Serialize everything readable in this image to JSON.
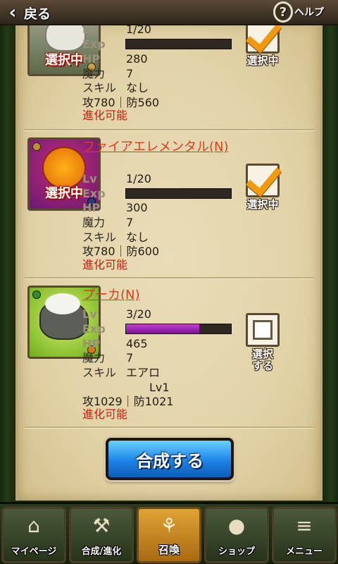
{
  "topbar": {
    "back_label": "戻る",
    "help_label": "ヘルプ"
  },
  "labels": {
    "lv": "Lv",
    "exp": "Exp",
    "hp": "HP",
    "magic": "魔力",
    "skill": "スキル",
    "selected_thumb": "選択中",
    "selected_btn": "選択中",
    "select_btn": "選択する"
  },
  "cards": [
    {
      "name": "",
      "lv": "1/20",
      "exp_fraction": 0.0,
      "hp": "280",
      "magic": "7",
      "skill": "なし",
      "atk_def": "攻780｜防560",
      "evolve": "進化可能",
      "selected": true
    },
    {
      "name": "ファイアエレメンタル(N)",
      "lv": "1/20",
      "exp_fraction": 0.0,
      "hp": "300",
      "magic": "7",
      "skill": "なし",
      "atk_def": "攻780｜防600",
      "evolve": "進化可能",
      "selected": true
    },
    {
      "name": "プーカ(N)",
      "lv": "3/20",
      "exp_fraction": 0.7,
      "hp": "465",
      "magic": "7",
      "skill": "エアロ",
      "skill_level": "Lv1",
      "atk_def": "攻1029｜防1021",
      "evolve": "進化可能",
      "selected": false
    }
  ],
  "compose_button": "合成する",
  "nav": [
    {
      "label": "マイページ",
      "icon": "home-icon"
    },
    {
      "label": "合成/進化",
      "icon": "wrench-icon"
    },
    {
      "label": "召喚",
      "icon": "summon-icon",
      "active": true
    },
    {
      "label": "ショップ",
      "icon": "bag-icon"
    },
    {
      "label": "メニュー",
      "icon": "menu-icon"
    }
  ],
  "colors": {
    "evolve": "#d11a0c",
    "name": "#d7401c",
    "exp_fill": "#a02cc0",
    "compose_button": "#1d83e6",
    "nav_active": "#d0921e"
  }
}
